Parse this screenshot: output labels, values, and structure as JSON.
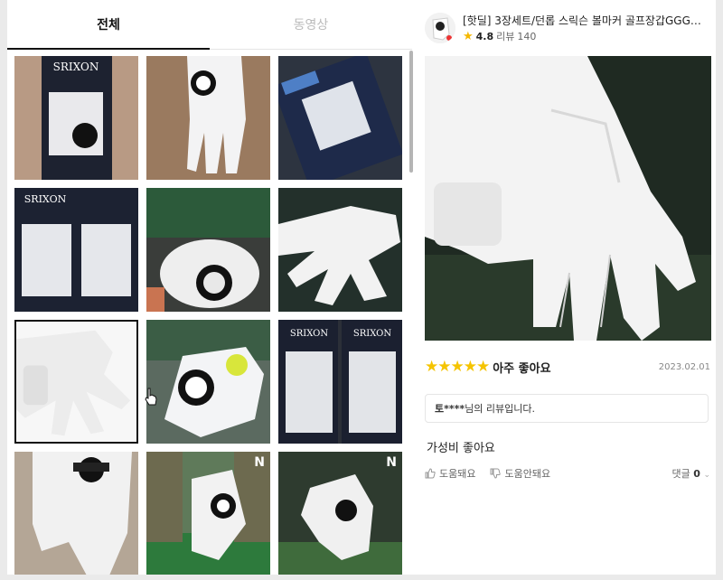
{
  "tabs": {
    "all": "전체",
    "video": "동영상"
  },
  "grid": {
    "badge": "N",
    "thumbs": [
      {
        "name": "thumb-1"
      },
      {
        "name": "thumb-2"
      },
      {
        "name": "thumb-3"
      },
      {
        "name": "thumb-4"
      },
      {
        "name": "thumb-5"
      },
      {
        "name": "thumb-6"
      },
      {
        "name": "thumb-7"
      },
      {
        "name": "thumb-8"
      },
      {
        "name": "thumb-9"
      },
      {
        "name": "thumb-10"
      },
      {
        "name": "thumb-11"
      },
      {
        "name": "thumb-12"
      }
    ],
    "selected_index": 7,
    "brand_text": "SRIXON"
  },
  "product": {
    "title": "[핫딜] 3장세트/던롭 스릭슨 볼마커 골프장갑GGG…",
    "rating": "4.8",
    "review_label": "리뷰",
    "review_count": "140"
  },
  "review": {
    "stars": "★★★★★",
    "rating_text": "아주 좋아요",
    "date": "2023.02.01",
    "reviewer_name": "토****",
    "reviewer_suffix": "님의 리뷰입니다.",
    "body": "가성비 좋아요",
    "helpful_label": "도움돼요",
    "not_helpful_label": "도움안돼요",
    "comments_label": "댓글",
    "comments_count": "0"
  },
  "colors": {
    "star": "#f5c400",
    "accent": "#111111"
  }
}
